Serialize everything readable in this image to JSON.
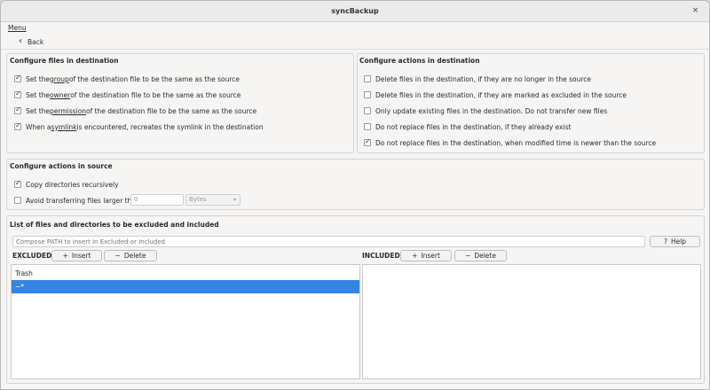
{
  "window": {
    "title": "syncBackup",
    "close_glyph": "×"
  },
  "menubar": {
    "menu_label": "Menu"
  },
  "toolbar": {
    "back_label": "Back"
  },
  "dest_files": {
    "title": "Configure files in destination",
    "items": [
      {
        "pre": "Set the ",
        "u": "group",
        "post": " of the destination file to be the same as the source",
        "checked": true
      },
      {
        "pre": "Set the ",
        "u": "owner",
        "post": " of the destination file to be the same as the source",
        "checked": true
      },
      {
        "pre": "Set the ",
        "u": "permission",
        "post": " of the destination file to be the same as the source",
        "checked": true
      },
      {
        "pre": "When a ",
        "u": "symlink",
        "post": " is encountered, recreates the symlink in the destination",
        "checked": true
      }
    ]
  },
  "dest_actions": {
    "title": "Configure actions in destination",
    "items": [
      {
        "text": "Delete files in the destination, if they are no longer in the source",
        "checked": false
      },
      {
        "text": "Delete files in the destination, if they are marked as excluded in the source",
        "checked": false
      },
      {
        "text": "Only update existing files in the destination. Do not transfer new files",
        "checked": false
      },
      {
        "text": "Do not replace files in the destination, if they already exist",
        "checked": false
      },
      {
        "text": "Do not replace files in the destination, when modified time is newer than the source",
        "checked": true
      }
    ]
  },
  "source_actions": {
    "title": "Configure actions in source",
    "copy_recursive": {
      "text": "Copy directories recursively",
      "checked": true
    },
    "avoid_large": {
      "text": "Avoid transferring files larger than",
      "checked": false
    },
    "size_value": "0",
    "unit_value": "Bytes"
  },
  "filters": {
    "title": "List of files and directories to be excluded and included",
    "path_placeholder": "Compose PATH to insert in Excluded or Included",
    "help_label": "Help",
    "excluded_label": "EXCLUDED",
    "included_label": "INCLUDED",
    "insert_label": "Insert",
    "delete_label": "Delete",
    "excluded_items": [
      "Trash",
      "~*"
    ],
    "included_items": []
  },
  "colors": {
    "selection": "#3584e4",
    "window_bg": "#f6f5f4"
  },
  "icons": {
    "back": "chevron-left-icon",
    "help": "question-icon",
    "insert": "plus-icon",
    "delete": "minus-icon",
    "close": "close-icon"
  }
}
